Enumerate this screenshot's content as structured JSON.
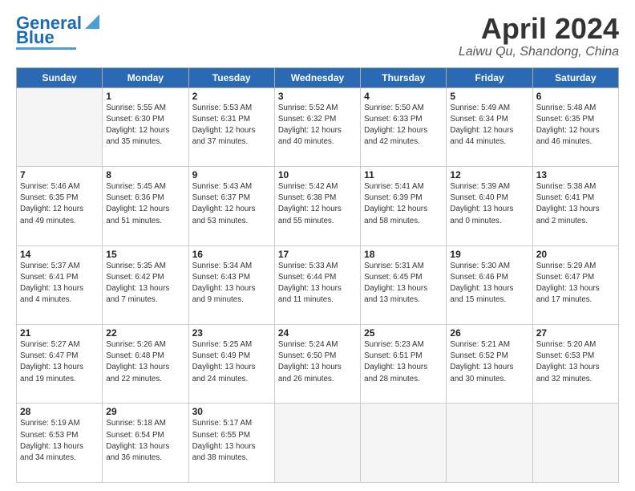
{
  "header": {
    "logo_line1": "General",
    "logo_line2": "Blue",
    "month": "April 2024",
    "location": "Laiwu Qu, Shandong, China"
  },
  "weekdays": [
    "Sunday",
    "Monday",
    "Tuesday",
    "Wednesday",
    "Thursday",
    "Friday",
    "Saturday"
  ],
  "weeks": [
    [
      {
        "day": "",
        "info": ""
      },
      {
        "day": "1",
        "info": "Sunrise: 5:55 AM\nSunset: 6:30 PM\nDaylight: 12 hours\nand 35 minutes."
      },
      {
        "day": "2",
        "info": "Sunrise: 5:53 AM\nSunset: 6:31 PM\nDaylight: 12 hours\nand 37 minutes."
      },
      {
        "day": "3",
        "info": "Sunrise: 5:52 AM\nSunset: 6:32 PM\nDaylight: 12 hours\nand 40 minutes."
      },
      {
        "day": "4",
        "info": "Sunrise: 5:50 AM\nSunset: 6:33 PM\nDaylight: 12 hours\nand 42 minutes."
      },
      {
        "day": "5",
        "info": "Sunrise: 5:49 AM\nSunset: 6:34 PM\nDaylight: 12 hours\nand 44 minutes."
      },
      {
        "day": "6",
        "info": "Sunrise: 5:48 AM\nSunset: 6:35 PM\nDaylight: 12 hours\nand 46 minutes."
      }
    ],
    [
      {
        "day": "7",
        "info": "Sunrise: 5:46 AM\nSunset: 6:35 PM\nDaylight: 12 hours\nand 49 minutes."
      },
      {
        "day": "8",
        "info": "Sunrise: 5:45 AM\nSunset: 6:36 PM\nDaylight: 12 hours\nand 51 minutes."
      },
      {
        "day": "9",
        "info": "Sunrise: 5:43 AM\nSunset: 6:37 PM\nDaylight: 12 hours\nand 53 minutes."
      },
      {
        "day": "10",
        "info": "Sunrise: 5:42 AM\nSunset: 6:38 PM\nDaylight: 12 hours\nand 55 minutes."
      },
      {
        "day": "11",
        "info": "Sunrise: 5:41 AM\nSunset: 6:39 PM\nDaylight: 12 hours\nand 58 minutes."
      },
      {
        "day": "12",
        "info": "Sunrise: 5:39 AM\nSunset: 6:40 PM\nDaylight: 13 hours\nand 0 minutes."
      },
      {
        "day": "13",
        "info": "Sunrise: 5:38 AM\nSunset: 6:41 PM\nDaylight: 13 hours\nand 2 minutes."
      }
    ],
    [
      {
        "day": "14",
        "info": "Sunrise: 5:37 AM\nSunset: 6:41 PM\nDaylight: 13 hours\nand 4 minutes."
      },
      {
        "day": "15",
        "info": "Sunrise: 5:35 AM\nSunset: 6:42 PM\nDaylight: 13 hours\nand 7 minutes."
      },
      {
        "day": "16",
        "info": "Sunrise: 5:34 AM\nSunset: 6:43 PM\nDaylight: 13 hours\nand 9 minutes."
      },
      {
        "day": "17",
        "info": "Sunrise: 5:33 AM\nSunset: 6:44 PM\nDaylight: 13 hours\nand 11 minutes."
      },
      {
        "day": "18",
        "info": "Sunrise: 5:31 AM\nSunset: 6:45 PM\nDaylight: 13 hours\nand 13 minutes."
      },
      {
        "day": "19",
        "info": "Sunrise: 5:30 AM\nSunset: 6:46 PM\nDaylight: 13 hours\nand 15 minutes."
      },
      {
        "day": "20",
        "info": "Sunrise: 5:29 AM\nSunset: 6:47 PM\nDaylight: 13 hours\nand 17 minutes."
      }
    ],
    [
      {
        "day": "21",
        "info": "Sunrise: 5:27 AM\nSunset: 6:47 PM\nDaylight: 13 hours\nand 19 minutes."
      },
      {
        "day": "22",
        "info": "Sunrise: 5:26 AM\nSunset: 6:48 PM\nDaylight: 13 hours\nand 22 minutes."
      },
      {
        "day": "23",
        "info": "Sunrise: 5:25 AM\nSunset: 6:49 PM\nDaylight: 13 hours\nand 24 minutes."
      },
      {
        "day": "24",
        "info": "Sunrise: 5:24 AM\nSunset: 6:50 PM\nDaylight: 13 hours\nand 26 minutes."
      },
      {
        "day": "25",
        "info": "Sunrise: 5:23 AM\nSunset: 6:51 PM\nDaylight: 13 hours\nand 28 minutes."
      },
      {
        "day": "26",
        "info": "Sunrise: 5:21 AM\nSunset: 6:52 PM\nDaylight: 13 hours\nand 30 minutes."
      },
      {
        "day": "27",
        "info": "Sunrise: 5:20 AM\nSunset: 6:53 PM\nDaylight: 13 hours\nand 32 minutes."
      }
    ],
    [
      {
        "day": "28",
        "info": "Sunrise: 5:19 AM\nSunset: 6:53 PM\nDaylight: 13 hours\nand 34 minutes."
      },
      {
        "day": "29",
        "info": "Sunrise: 5:18 AM\nSunset: 6:54 PM\nDaylight: 13 hours\nand 36 minutes."
      },
      {
        "day": "30",
        "info": "Sunrise: 5:17 AM\nSunset: 6:55 PM\nDaylight: 13 hours\nand 38 minutes."
      },
      {
        "day": "",
        "info": ""
      },
      {
        "day": "",
        "info": ""
      },
      {
        "day": "",
        "info": ""
      },
      {
        "day": "",
        "info": ""
      }
    ]
  ]
}
